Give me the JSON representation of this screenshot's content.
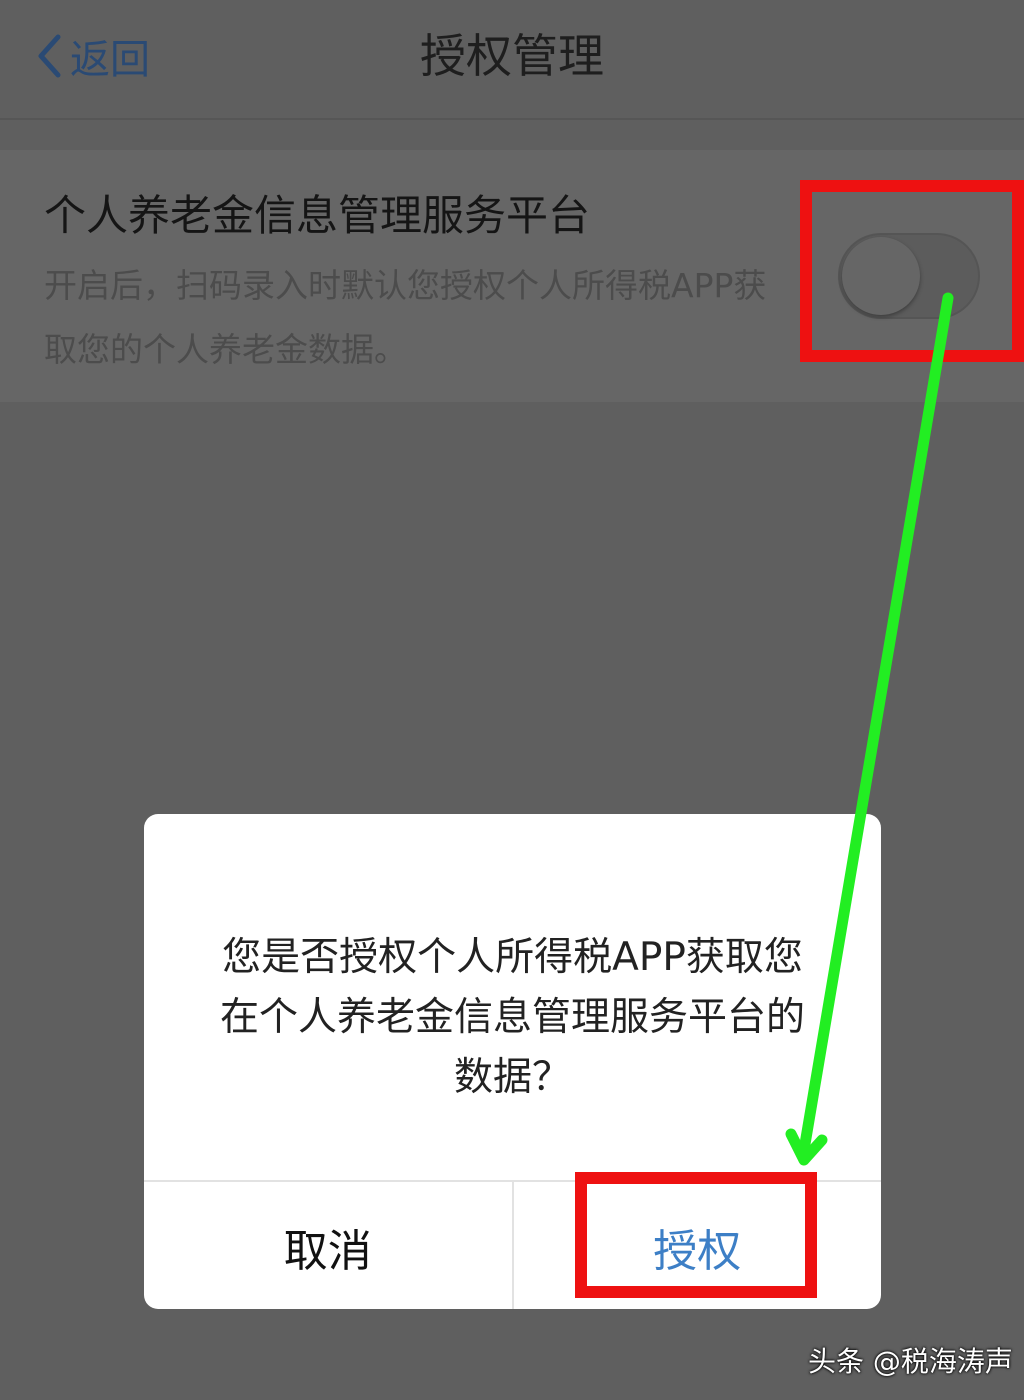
{
  "navbar": {
    "back_label": "返回",
    "title": "授权管理"
  },
  "setting": {
    "title": "个人养老金信息管理服务平台",
    "description": "开启后，扫码录入时默认您授权个人所得税APP获取您的个人养老金数据。",
    "toggle_on": false
  },
  "dialog": {
    "message": "您是否授权个人所得税APP获取您在个人养老金信息管理服务平台的数据？",
    "cancel_label": "取消",
    "grant_label": "授权"
  },
  "watermark": {
    "text": "头条 @税海涛声"
  },
  "colors": {
    "annotation_box": "#ee1111",
    "annotation_arrow": "#22ee22",
    "grant_button": "#3d7fc6"
  }
}
